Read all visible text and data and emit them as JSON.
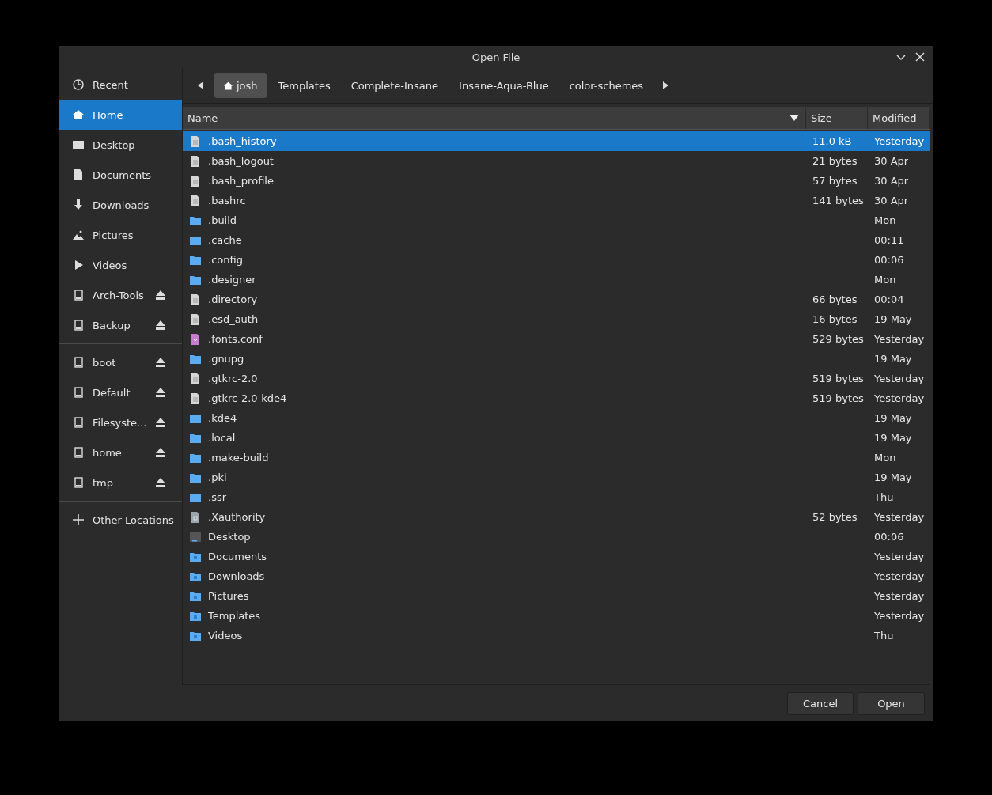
{
  "window": {
    "title": "Open File"
  },
  "sidebar": {
    "sections": [
      [
        {
          "label": "Recent",
          "kind": "recent",
          "selected": false,
          "eject": false
        },
        {
          "label": "Home",
          "kind": "home",
          "selected": true,
          "eject": false
        },
        {
          "label": "Desktop",
          "kind": "desktop",
          "selected": false,
          "eject": false
        },
        {
          "label": "Documents",
          "kind": "document",
          "selected": false,
          "eject": false
        },
        {
          "label": "Downloads",
          "kind": "download",
          "selected": false,
          "eject": false
        },
        {
          "label": "Pictures",
          "kind": "pictures",
          "selected": false,
          "eject": false
        },
        {
          "label": "Videos",
          "kind": "videos",
          "selected": false,
          "eject": false
        },
        {
          "label": "Arch-Tools",
          "kind": "drive",
          "selected": false,
          "eject": true
        },
        {
          "label": "Backup",
          "kind": "drive",
          "selected": false,
          "eject": true
        }
      ],
      [
        {
          "label": "boot",
          "kind": "drive",
          "selected": false,
          "eject": true
        },
        {
          "label": "Default",
          "kind": "drive",
          "selected": false,
          "eject": true
        },
        {
          "label": "Filesyste...",
          "kind": "drive",
          "selected": false,
          "eject": true
        },
        {
          "label": "home",
          "kind": "drive",
          "selected": false,
          "eject": true
        },
        {
          "label": "tmp",
          "kind": "drive",
          "selected": false,
          "eject": true
        }
      ],
      [
        {
          "label": "Other Locations",
          "kind": "plus",
          "selected": false,
          "eject": false
        }
      ]
    ]
  },
  "path_bar": {
    "crumbs": [
      {
        "label": "josh",
        "home": true,
        "selected": true
      },
      {
        "label": "Templates",
        "home": false,
        "selected": false
      },
      {
        "label": "Complete-Insane",
        "home": false,
        "selected": false
      },
      {
        "label": "Insane-Aqua-Blue",
        "home": false,
        "selected": false
      },
      {
        "label": "color-schemes",
        "home": false,
        "selected": false
      }
    ]
  },
  "table": {
    "columns": [
      "Name",
      "Size",
      "Modified"
    ],
    "rows": [
      {
        "name": ".bash_history",
        "kind": "text",
        "size": "11.0 kB",
        "modified": "Yesterday",
        "selected": true
      },
      {
        "name": ".bash_logout",
        "kind": "text",
        "size": "21 bytes",
        "modified": "30 Apr",
        "selected": false
      },
      {
        "name": ".bash_profile",
        "kind": "text",
        "size": "57 bytes",
        "modified": "30 Apr",
        "selected": false
      },
      {
        "name": ".bashrc",
        "kind": "text",
        "size": "141 bytes",
        "modified": "30 Apr",
        "selected": false
      },
      {
        "name": ".build",
        "kind": "folder",
        "modified": "Mon",
        "selected": false
      },
      {
        "name": ".cache",
        "kind": "folder",
        "modified": "00:11",
        "selected": false
      },
      {
        "name": ".config",
        "kind": "folder",
        "modified": "00:06",
        "selected": false
      },
      {
        "name": ".designer",
        "kind": "folder",
        "modified": "Mon",
        "selected": false
      },
      {
        "name": ".directory",
        "kind": "text",
        "size": "66 bytes",
        "modified": "00:04",
        "selected": false
      },
      {
        "name": ".esd_auth",
        "kind": "text",
        "size": "16 bytes",
        "modified": "19 May",
        "selected": false
      },
      {
        "name": ".fonts.conf",
        "kind": "xml",
        "size": "529 bytes",
        "modified": "Yesterday",
        "selected": false
      },
      {
        "name": ".gnupg",
        "kind": "folder",
        "modified": "19 May",
        "selected": false
      },
      {
        "name": ".gtkrc-2.0",
        "kind": "text",
        "size": "519 bytes",
        "modified": "Yesterday",
        "selected": false
      },
      {
        "name": ".gtkrc-2.0-kde4",
        "kind": "text",
        "size": "519 bytes",
        "modified": "Yesterday",
        "selected": false
      },
      {
        "name": ".kde4",
        "kind": "folder",
        "modified": "19 May",
        "selected": false
      },
      {
        "name": ".local",
        "kind": "folder",
        "modified": "19 May",
        "selected": false
      },
      {
        "name": ".make-build",
        "kind": "folder",
        "modified": "Mon",
        "selected": false
      },
      {
        "name": ".pki",
        "kind": "folder",
        "modified": "19 May",
        "selected": false
      },
      {
        "name": ".ssr",
        "kind": "folder",
        "modified": "Thu",
        "selected": false
      },
      {
        "name": ".Xauthority",
        "kind": "binary",
        "size": "52 bytes",
        "modified": "Yesterday",
        "selected": false
      },
      {
        "name": "Desktop",
        "kind": "desktop",
        "modified": "00:06",
        "selected": false
      },
      {
        "name": "Documents",
        "kind": "special-folder",
        "modified": "Yesterday",
        "selected": false
      },
      {
        "name": "Downloads",
        "kind": "special-folder",
        "modified": "Yesterday",
        "selected": false
      },
      {
        "name": "Pictures",
        "kind": "special-folder",
        "modified": "Yesterday",
        "selected": false
      },
      {
        "name": "Templates",
        "kind": "special-folder",
        "modified": "Yesterday",
        "selected": false
      },
      {
        "name": "Videos",
        "kind": "special-folder",
        "modified": "Thu",
        "selected": false
      }
    ]
  },
  "buttons": [
    "Cancel",
    "Open"
  ]
}
